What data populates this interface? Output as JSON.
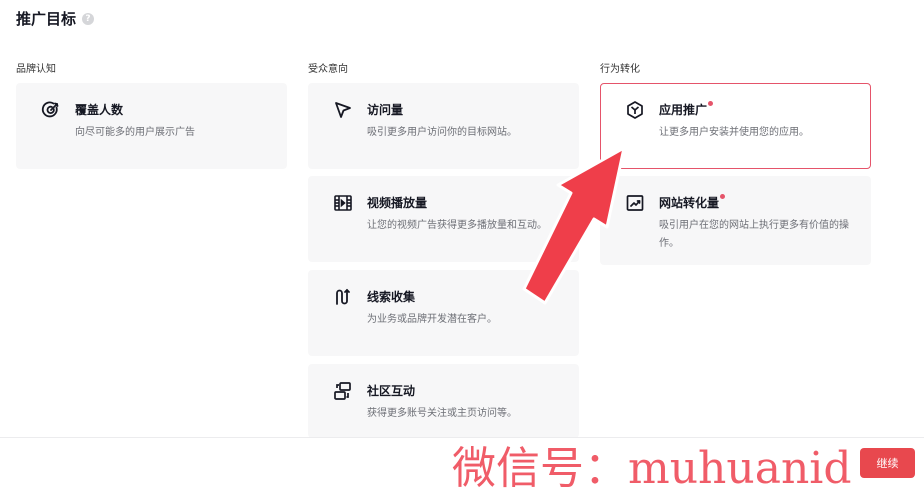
{
  "header": {
    "title": "推广目标",
    "help_icon": "question-circle-icon"
  },
  "columns": [
    {
      "label": "品牌认知"
    },
    {
      "label": "受众意向"
    },
    {
      "label": "行为转化"
    }
  ],
  "cards": {
    "reach": {
      "title": "覆盖人数",
      "desc": "向尽可能多的用户展示广告",
      "icon": "target-icon"
    },
    "traffic": {
      "title": "访问量",
      "desc": "吸引更多用户访问你的目标网站。",
      "icon": "cursor-icon"
    },
    "video_views": {
      "title": "视频播放量",
      "desc": "让您的视频广告获得更多播放量和互动。",
      "icon": "film-icon"
    },
    "leads": {
      "title": "线索收集",
      "desc": "为业务或品牌开发潜在客户。",
      "icon": "funnel-icon"
    },
    "community": {
      "title": "社区互动",
      "desc": "获得更多账号关注或主页访问等。",
      "icon": "community-icon"
    },
    "app_promotion": {
      "title": "应用推广",
      "desc": "让更多用户安装并使用您的应用。",
      "icon": "app-icon",
      "selected": true
    },
    "conversions": {
      "title": "网站转化量",
      "desc": "吸引用户在您的网站上执行更多有价值的操作。",
      "icon": "chart-up-icon"
    }
  },
  "footer": {
    "next_label": "继续"
  },
  "watermark": {
    "text": "微信号：muhuanid"
  },
  "colors": {
    "accent": "#e8484e",
    "card_bg": "#f7f7f8",
    "arrow": "#ef3e4a"
  }
}
